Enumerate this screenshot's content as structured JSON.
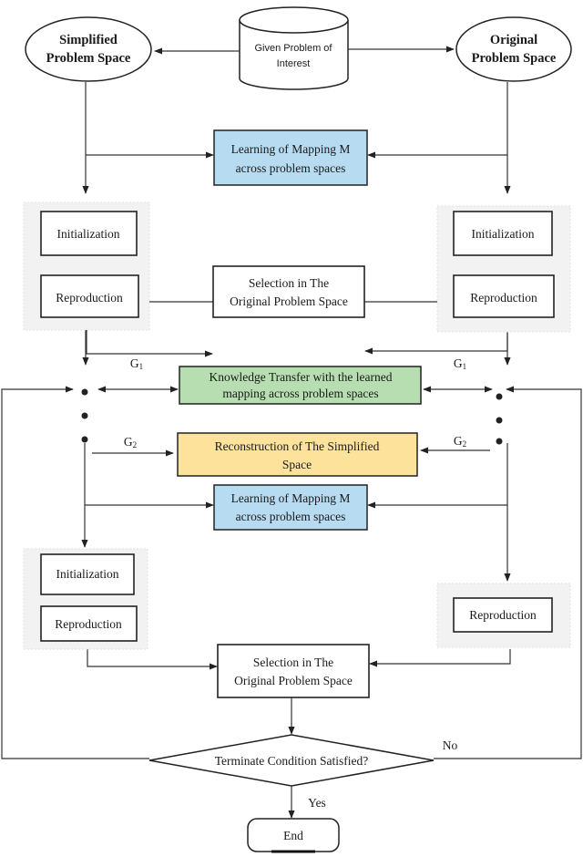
{
  "start": {
    "line1": "Given Problem of",
    "line2": "Interest"
  },
  "simplified_space": {
    "line1": "Simplified",
    "line2": "Problem Space"
  },
  "original_space": {
    "line1": "Original",
    "line2": "Problem Space"
  },
  "learning_mapping": {
    "line1": "Learning of Mapping M",
    "line2": "across problem spaces"
  },
  "initialization": "Initialization",
  "reproduction": "Reproduction",
  "selection": {
    "line1": "Selection in The",
    "line2": "Original Problem Space"
  },
  "knowledge_transfer": {
    "line1": "Knowledge Transfer with the learned",
    "line2": "mapping across problem spaces"
  },
  "reconstruction": {
    "line1": "Reconstruction of The Simplified",
    "line2": "Space"
  },
  "g1": {
    "base": "G",
    "sub": "1"
  },
  "g2": {
    "base": "G",
    "sub": "2"
  },
  "decision": "Terminate Condition Satisfied?",
  "no_label": "No",
  "yes_label": "Yes",
  "end": "End",
  "colors": {
    "learning": "#b7dcf2",
    "knowledge": "#b6deb0",
    "reconstruction": "#fde29c",
    "group": "#f2f2f2"
  }
}
